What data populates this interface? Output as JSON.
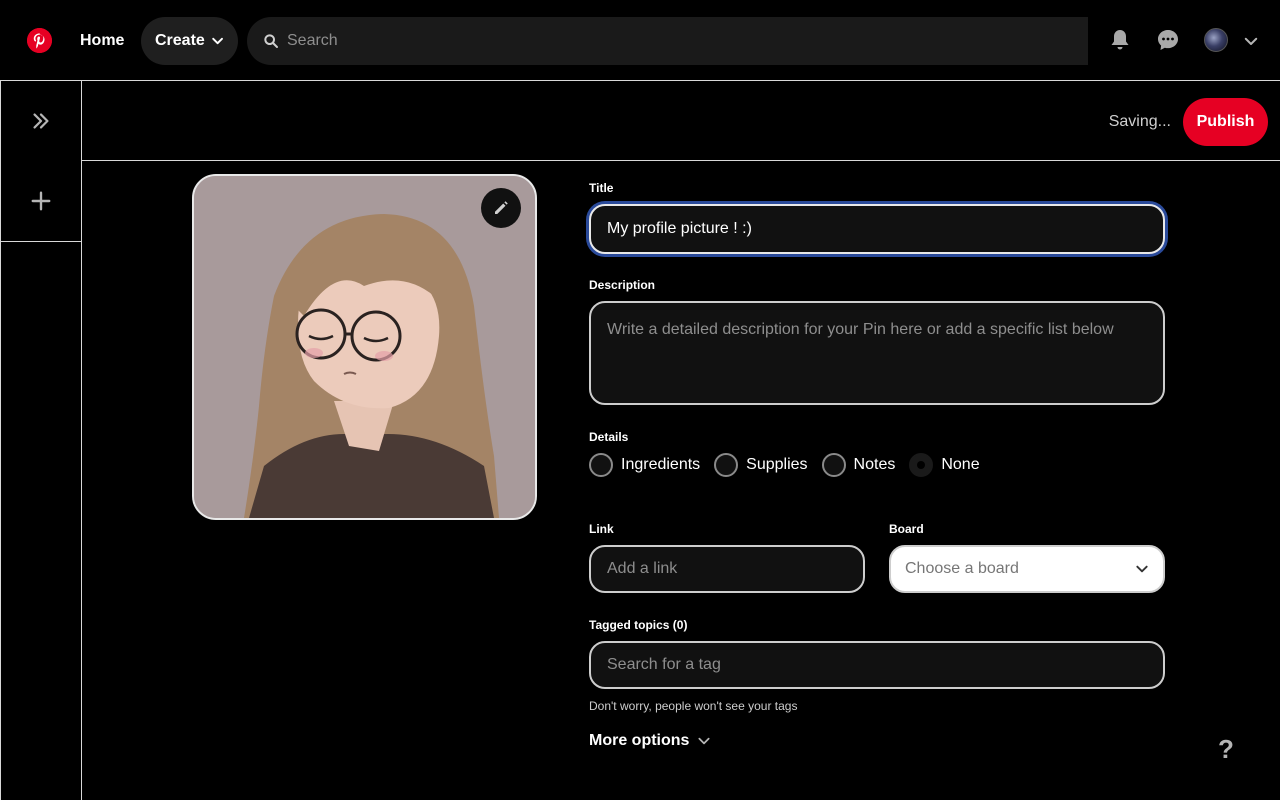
{
  "nav": {
    "home_label": "Home",
    "create_label": "Create",
    "search_placeholder": "Search"
  },
  "header": {
    "status_text": "Saving...",
    "publish_label": "Publish"
  },
  "form": {
    "title_label": "Title",
    "title_value": "My profile picture ! :)",
    "description_label": "Description",
    "description_placeholder": "Write a detailed description for your Pin here or add a specific list below",
    "details_label": "Details",
    "details_options": [
      "Ingredients",
      "Supplies",
      "Notes",
      "None"
    ],
    "details_selected": "None",
    "link_label": "Link",
    "link_placeholder": "Add a link",
    "board_label": "Board",
    "board_value": "Choose a board",
    "tagged_topics_label": "Tagged topics (0)",
    "tag_placeholder": "Search for a tag",
    "tag_hint": "Don't worry, people won't see your tags",
    "more_options_label": "More options"
  },
  "help_label": "?",
  "colors": {
    "brand_red": "#e60023",
    "background": "#000000",
    "focus_ring": "#2a4a9a"
  },
  "icons": {
    "logo": "pinterest-logo",
    "search": "search-icon",
    "notifications": "bell-icon",
    "messages": "chat-bubble-icon",
    "expand_sidebar": "double-chevron-right-icon",
    "add": "plus-icon",
    "edit": "pencil-icon"
  }
}
